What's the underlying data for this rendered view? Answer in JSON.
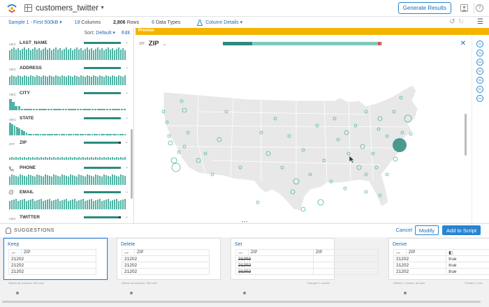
{
  "app": {
    "dataset_name": "customers_twitter",
    "generate_label": "Generate Results"
  },
  "infobar": {
    "sample": "Sample 1 - First 500kB",
    "columns_count": "18",
    "columns_label": "Columns",
    "rows_count": "2,806",
    "rows_label": "Rows",
    "types_count": "6",
    "types_label": "Data Types",
    "column_details": "Column Details"
  },
  "sortbar": {
    "sort_label": "Sort:",
    "sort_value": "Default",
    "edit_label": "Edit"
  },
  "columns": [
    {
      "type": "ABC",
      "name": "LAST_NAME"
    },
    {
      "type": "ABC",
      "name": "ADDRESS"
    },
    {
      "type": "ABC",
      "name": "CITY"
    },
    {
      "type": "ABC",
      "name": "STATE"
    },
    {
      "type": "ZIP",
      "name": "ZIP"
    },
    {
      "type": "",
      "name": "PHONE"
    },
    {
      "type": "",
      "name": "EMAIL"
    },
    {
      "type": "ABC",
      "name": "TWITTER"
    }
  ],
  "preview": {
    "label": "Preview",
    "type": "ZIP",
    "column": "ZIP"
  },
  "rail_icons": [
    "Sr",
    "Sp",
    "Me",
    "Ne",
    "Sp",
    "Sh",
    "Ka"
  ],
  "suggestions": {
    "title": "SUGGESTIONS",
    "cancel": "Cancel",
    "modify": "Modify",
    "add": "Add to Script"
  },
  "cards": [
    {
      "title": "Keep",
      "type": "ZIP",
      "col": "ZIP",
      "rows": [
        "21202",
        "21202",
        "21202"
      ],
      "foot": "Affects all columns, 5/6 rows"
    },
    {
      "title": "Delete",
      "type": "ZIP",
      "col": "ZIP",
      "rows": [
        "21202",
        "21202",
        "21202"
      ],
      "foot": "Affects all columns, 5/6 rows"
    },
    {
      "title": "Set",
      "type": "ZIP",
      "col": "ZIP",
      "col2": "ZIP",
      "rows": [
        "21202",
        "21202",
        "21202"
      ],
      "foot": "Changes 1 column"
    },
    {
      "title": "Derive",
      "type": "ZIP",
      "col": "ZIP",
      "rows": [
        "21202",
        "21202",
        "21202"
      ],
      "derived": [
        "true",
        "true",
        "true"
      ],
      "foot": "Affects 1 column, all rows",
      "foot2": "Creates 1 colu"
    }
  ],
  "colors": {
    "accent": "#2a84d0",
    "preview_bar": "#f5b400",
    "teal": "#51b3a5",
    "teal_dark": "#2c8a7c"
  }
}
